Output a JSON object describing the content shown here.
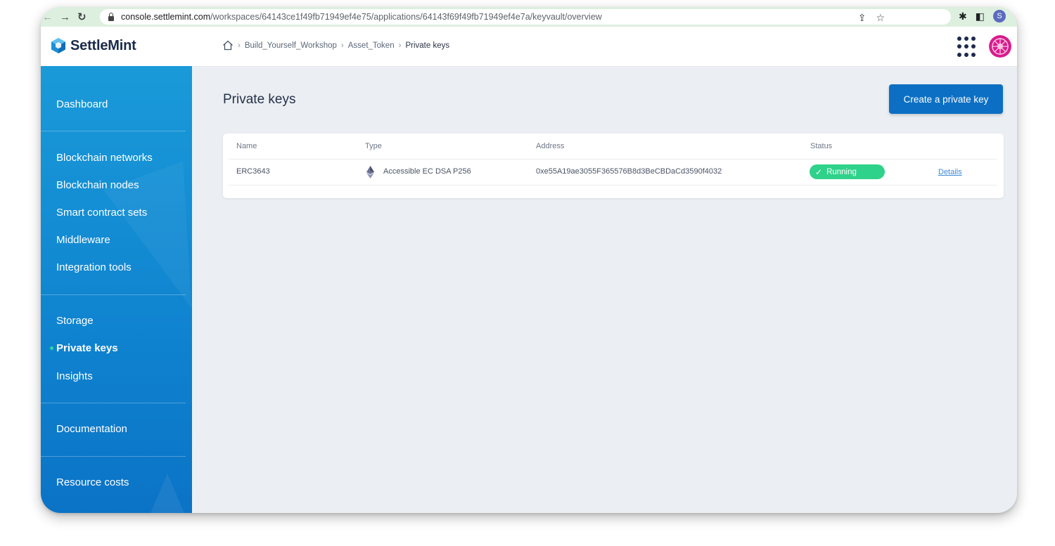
{
  "browser": {
    "url_host": "console.settlemint.com",
    "url_path": "/workspaces/64143ce1f49fb71949ef4e75/applications/64143f69f49fb71949ef4e7a/keyvault/overview",
    "profile_initial": "S"
  },
  "header": {
    "logo_text": "SettleMint",
    "breadcrumbs": [
      "Build_Yourself_Workshop",
      "Asset_Token",
      "Private keys"
    ]
  },
  "sidebar": {
    "items": [
      {
        "label": "Dashboard"
      },
      {
        "label": "Blockchain networks"
      },
      {
        "label": "Blockchain nodes"
      },
      {
        "label": "Smart contract sets"
      },
      {
        "label": "Middleware"
      },
      {
        "label": "Integration tools"
      },
      {
        "label": "Storage"
      },
      {
        "label": "Private keys",
        "active": true
      },
      {
        "label": "Insights"
      },
      {
        "label": "Documentation"
      },
      {
        "label": "Resource costs"
      }
    ]
  },
  "main": {
    "title": "Private keys",
    "create_button": "Create a private key",
    "table": {
      "columns": [
        "Name",
        "Type",
        "Address",
        "Status"
      ],
      "rows": [
        {
          "name": "ERC3643",
          "type": "Accessible EC DSA P256",
          "address": "0xe55A19ae3055F365576B8d3BeCBDaCd3590f4032",
          "status": "Running",
          "action": "Details"
        }
      ]
    }
  },
  "colors": {
    "sidebar": "#1190d4",
    "primary_button": "#0c6fc3",
    "status_running": "#2fd28a",
    "link": "#3a8ad9"
  }
}
